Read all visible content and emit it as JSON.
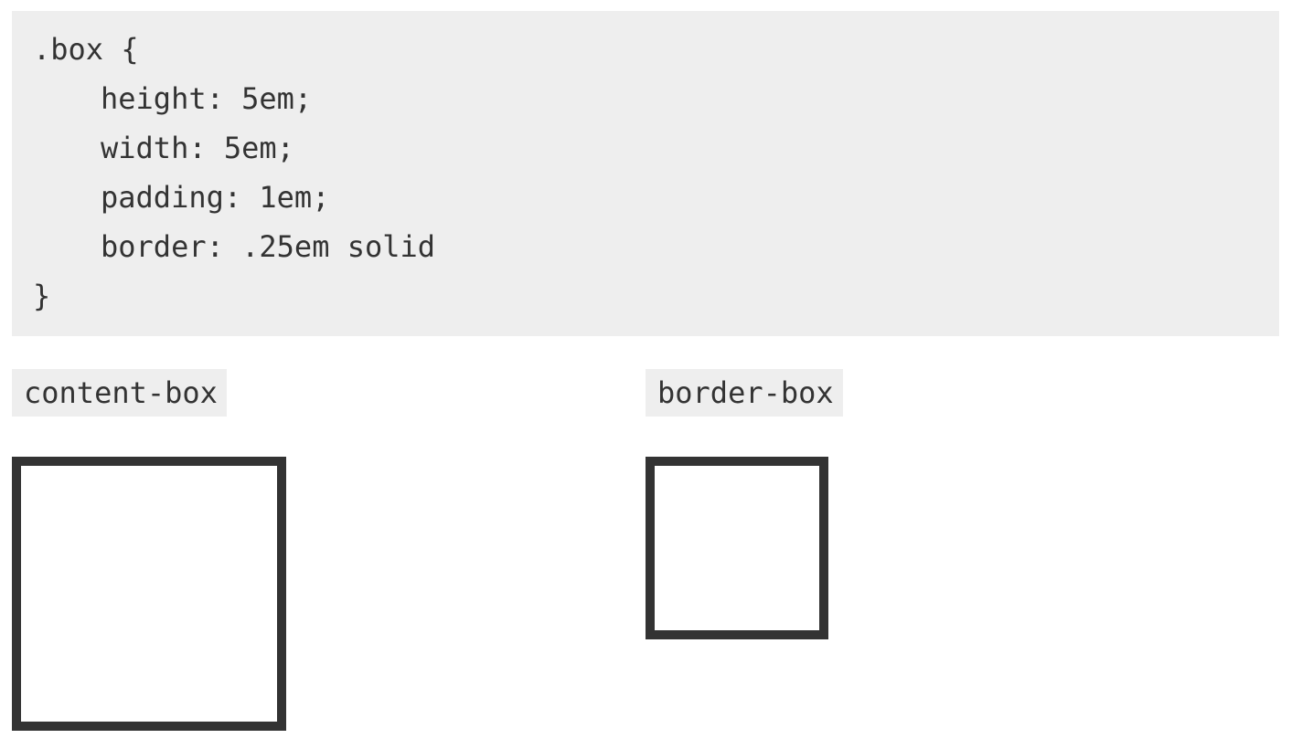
{
  "code": {
    "lines": [
      ".box {",
      "height: 5em;",
      "width: 5em;",
      "padding: 1em;",
      "border: .25em solid",
      "}"
    ]
  },
  "examples": [
    {
      "label": "content-box"
    },
    {
      "label": "border-box"
    }
  ],
  "colors": {
    "code_background": "#eeeeee",
    "text": "#333333",
    "box_border": "#333333",
    "page_background": "#ffffff"
  }
}
